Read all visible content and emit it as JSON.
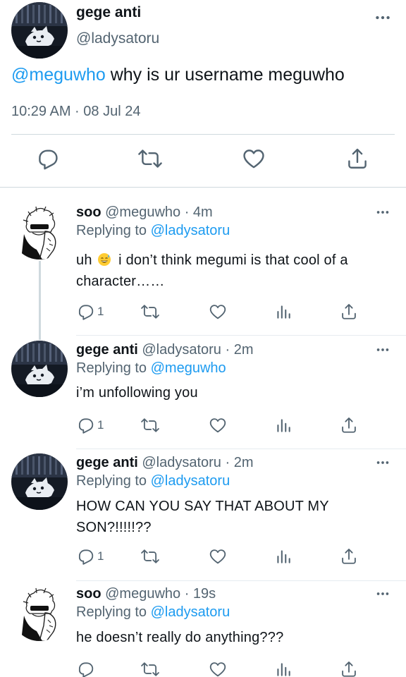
{
  "main_tweet": {
    "display_name": "gege anti",
    "handle": "@ladysatoru",
    "mention": "@meguwho",
    "text": " why is ur username meguwho",
    "timestamp": "10:29 AM · 08 Jul 24",
    "actions": [
      "reply-icon",
      "retweet-icon",
      "like-icon",
      "share-icon"
    ]
  },
  "replies": [
    {
      "display_name": "soo",
      "handle_time": " @meguwho · 4m",
      "replying_prefix": "Replying to ",
      "replying_to": "@ladysatoru",
      "text_before_emoji": "uh ",
      "emoji": "sweat-smile-emoji",
      "text_after_emoji": " i don’t think megumi is that cool of a character……",
      "reply_count": "1"
    },
    {
      "display_name": "gege anti",
      "handle_time": " @ladysatoru · 2m",
      "replying_prefix": "Replying to ",
      "replying_to": "@meguwho",
      "text": "i’m unfollowing you",
      "reply_count": "1"
    },
    {
      "display_name": "gege anti",
      "handle_time": " @ladysatoru · 2m",
      "replying_prefix": "Replying to ",
      "replying_to": "@ladysatoru",
      "text": "HOW CAN YOU SAY THAT ABOUT MY SON?!!!!!??",
      "reply_count": "1"
    },
    {
      "display_name": "soo",
      "handle_time": " @meguwho · 19s",
      "replying_prefix": "Replying to ",
      "replying_to": "@ladysatoru",
      "text": "he doesn’t really do anything???",
      "reply_count": ""
    }
  ],
  "colors": {
    "text": "#0f1419",
    "secondary": "#536471",
    "link": "#1d9bf0",
    "divider": "#cfd9de"
  }
}
